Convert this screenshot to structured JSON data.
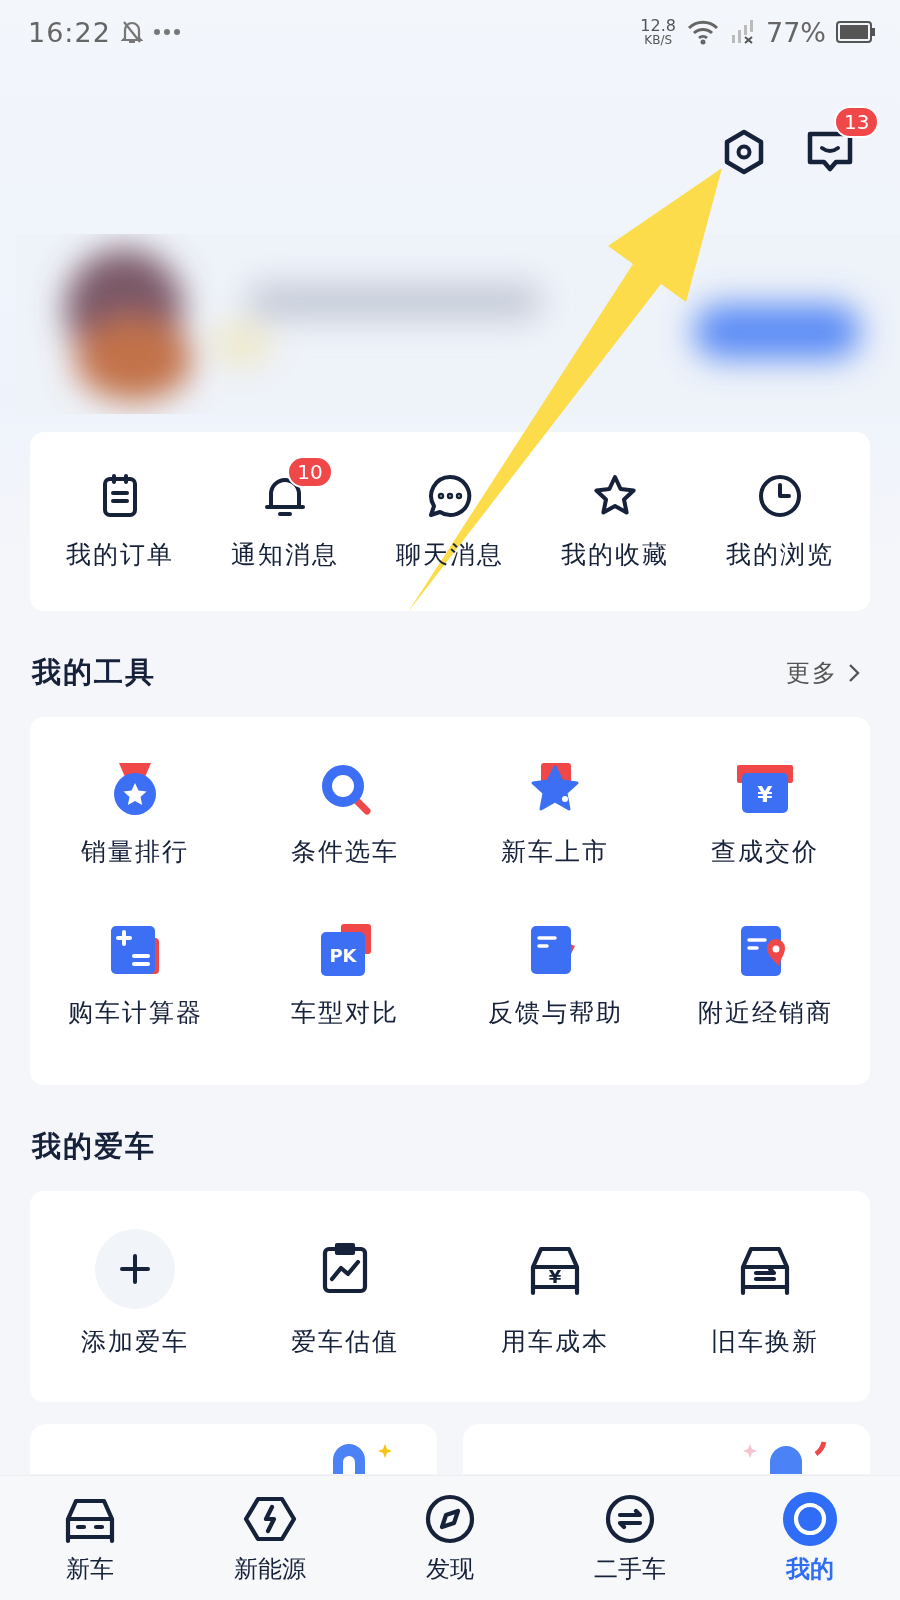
{
  "status_bar": {
    "time": "16:22",
    "net_speed": "12.8",
    "net_unit": "KB/S",
    "battery": "77%"
  },
  "header": {
    "message_badge": "13"
  },
  "shortcuts": [
    {
      "label": "我的订单",
      "kind": "order"
    },
    {
      "label": "通知消息",
      "kind": "bell",
      "badge": "10"
    },
    {
      "label": "聊天消息",
      "kind": "chat"
    },
    {
      "label": "我的收藏",
      "kind": "star"
    },
    {
      "label": "我的浏览",
      "kind": "clock"
    }
  ],
  "tools": {
    "title": "我的工具",
    "more": "更多",
    "items": [
      {
        "label": "销量排行",
        "kind": "medal"
      },
      {
        "label": "条件选车",
        "kind": "search"
      },
      {
        "label": "新车上市",
        "kind": "newstar"
      },
      {
        "label": "查成交价",
        "kind": "price",
        "glyph": "¥"
      },
      {
        "label": "购车计算器",
        "kind": "calc"
      },
      {
        "label": "车型对比",
        "kind": "pk",
        "glyph": "PK"
      },
      {
        "label": "反馈与帮助",
        "kind": "feedback"
      },
      {
        "label": "附近经销商",
        "kind": "dealer"
      }
    ]
  },
  "my_car": {
    "title": "我的爱车",
    "items": [
      {
        "label": "添加爱车",
        "kind": "plus"
      },
      {
        "label": "爱车估值",
        "kind": "chart"
      },
      {
        "label": "用车成本",
        "kind": "cost",
        "glyph": "¥"
      },
      {
        "label": "旧车换新",
        "kind": "swap"
      }
    ]
  },
  "tab_bar": [
    {
      "label": "新车",
      "kind": "car",
      "selected": false
    },
    {
      "label": "新能源",
      "kind": "energy",
      "selected": false
    },
    {
      "label": "发现",
      "kind": "compass",
      "selected": false
    },
    {
      "label": "二手车",
      "kind": "used",
      "selected": false
    },
    {
      "label": "我的",
      "kind": "me",
      "selected": true
    }
  ]
}
